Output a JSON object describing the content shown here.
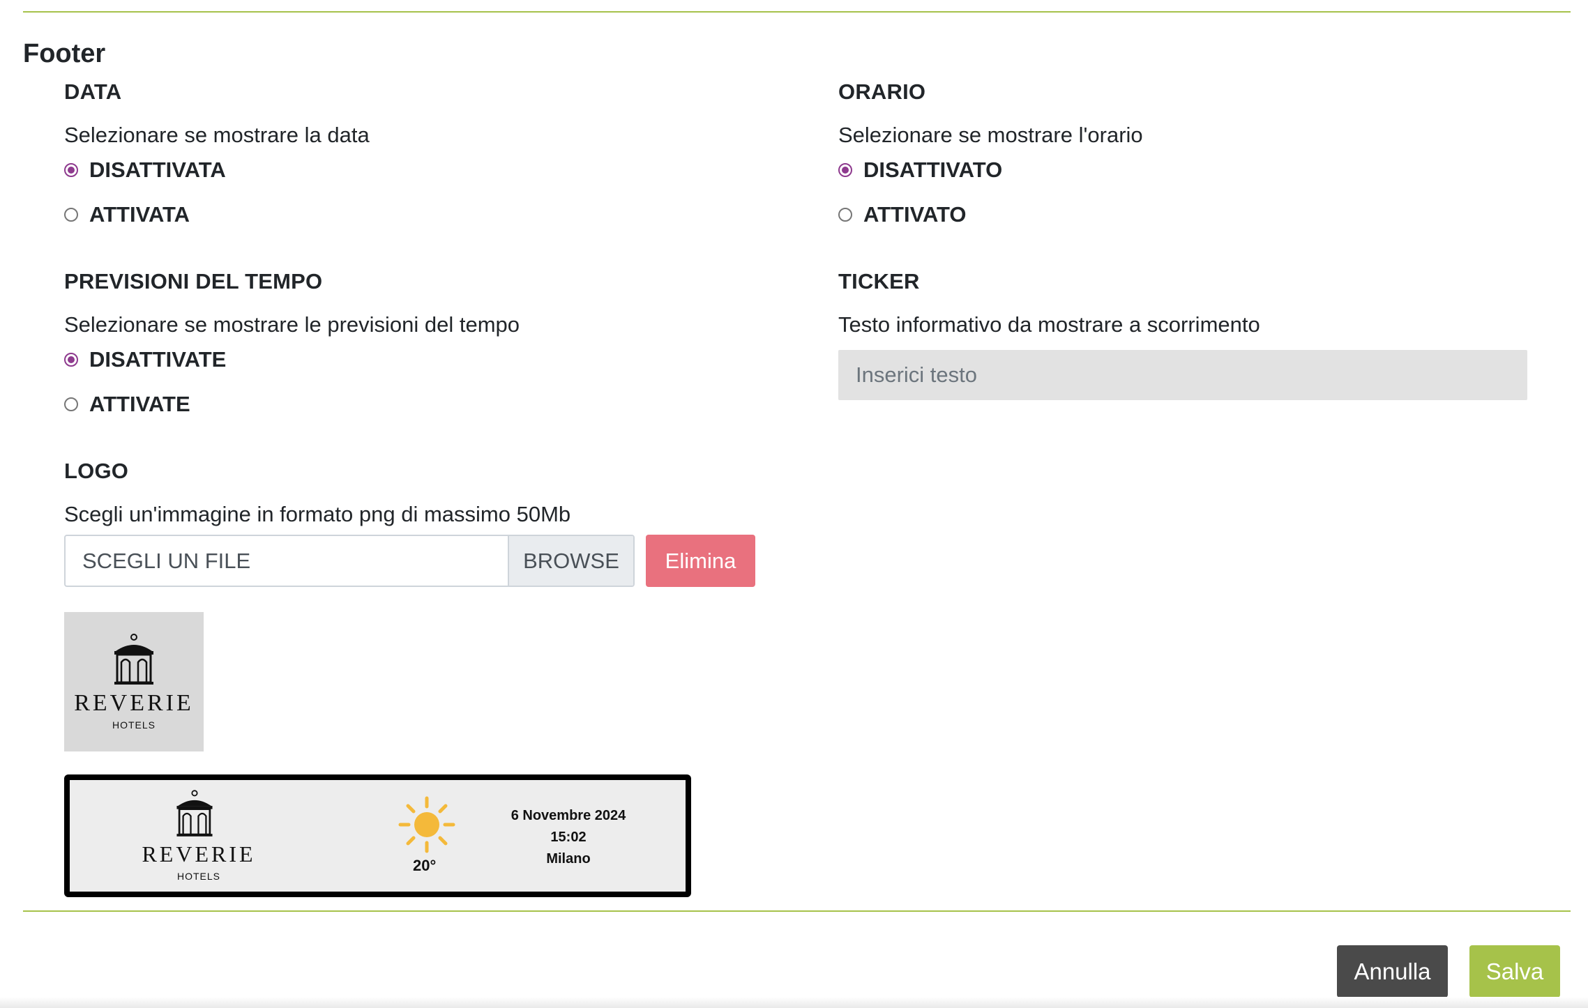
{
  "section": {
    "title": "Footer"
  },
  "data": {
    "title": "DATA",
    "description": "Selezionare se mostrare la data",
    "options": [
      "DISATTIVATA",
      "ATTIVATA"
    ],
    "selected": "DISATTIVATA"
  },
  "orario": {
    "title": "ORARIO",
    "description": "Selezionare se mostrare l'orario",
    "options": [
      "DISATTIVATO",
      "ATTIVATO"
    ],
    "selected": "DISATTIVATO"
  },
  "previsioni": {
    "title": "PREVISIONI DEL TEMPO",
    "description": "Selezionare se mostrare le previsioni del tempo",
    "options": [
      "DISATTIVATE",
      "ATTIVATE"
    ],
    "selected": "DISATTIVATE"
  },
  "ticker": {
    "title": "TICKER",
    "description": "Testo informativo da mostrare a scorrimento",
    "placeholder": "Inserici testo",
    "value": ""
  },
  "logo": {
    "title": "LOGO",
    "description": "Scegli un'immagine in formato png di massimo 50Mb",
    "file_placeholder": "SCEGLI UN FILE",
    "browse_label": "BROWSE",
    "delete_label": "Elimina",
    "brand_name": "REVERIE",
    "brand_sub": "HOTELS"
  },
  "preview": {
    "brand_name": "REVERIE",
    "brand_sub": "HOTELS",
    "weather_icon": "sun-icon",
    "temperature": "20°",
    "date": "6 Novembre 2024",
    "time": "15:02",
    "city": "Milano"
  },
  "actions": {
    "cancel_label": "Annulla",
    "save_label": "Salva"
  },
  "colors": {
    "accent_green": "#a6c24a",
    "radio_purple": "#8e3a8e",
    "delete_red": "#e9717e",
    "cancel_dark": "#4a4a4a"
  }
}
